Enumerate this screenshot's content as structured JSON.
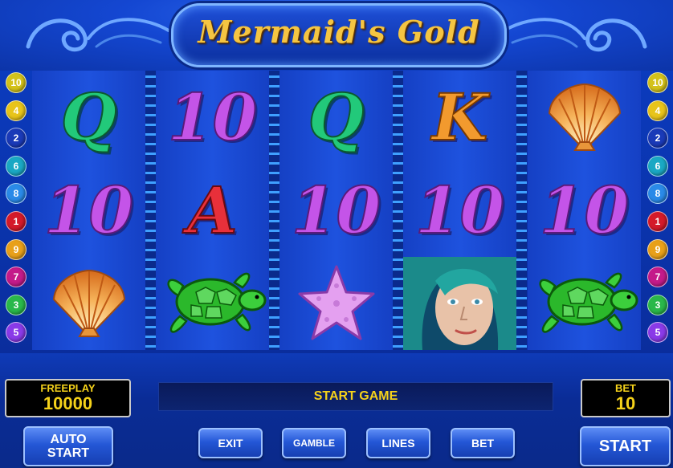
{
  "game": {
    "title": "Mermaid's Gold"
  },
  "reels": [
    [
      "Q",
      "10",
      "scallop-shell"
    ],
    [
      "10",
      "A",
      "sea-turtle"
    ],
    [
      "Q",
      "10",
      "starfish"
    ],
    [
      "K",
      "10",
      "mermaid"
    ],
    [
      "scallop-shell",
      "10",
      "sea-turtle"
    ]
  ],
  "paylines": {
    "left": [
      "10",
      "4",
      "2",
      "6",
      "8",
      "1",
      "9",
      "7",
      "3",
      "5"
    ],
    "right": [
      "10",
      "4",
      "2",
      "6",
      "8",
      "1",
      "9",
      "7",
      "3",
      "5"
    ],
    "colors": [
      "#d4c21a",
      "#e8c41a",
      "#1a3ab8",
      "#1aa8c4",
      "#2a8ae8",
      "#d41a2a",
      "#e8a01a",
      "#c41a8a",
      "#2ab84a",
      "#8a3ae8"
    ]
  },
  "freeplay": {
    "label": "FREEPLAY",
    "value": "10000"
  },
  "message": "START GAME",
  "bet": {
    "label": "BET",
    "value": "10"
  },
  "buttons": {
    "auto_start_line1": "AUTO",
    "auto_start_line2": "START",
    "exit": "EXIT",
    "gamble": "GAMBLE",
    "lines": "LINES",
    "bet": "BET",
    "start": "START"
  }
}
